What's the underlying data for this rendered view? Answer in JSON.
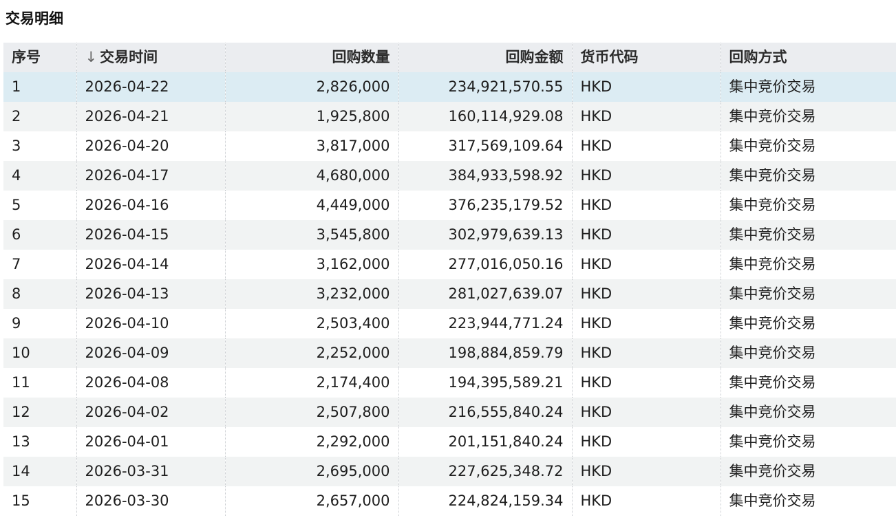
{
  "section": {
    "title": "交易明细"
  },
  "table": {
    "columns": [
      {
        "key": "seq",
        "label": "序号"
      },
      {
        "key": "time",
        "label": "交易时间",
        "sort_glyph": "↓"
      },
      {
        "key": "qty",
        "label": "回购数量"
      },
      {
        "key": "amount",
        "label": "回购金额"
      },
      {
        "key": "currency",
        "label": "货币代码"
      },
      {
        "key": "method",
        "label": "回购方式"
      }
    ],
    "selected_row": 0,
    "rows": [
      {
        "seq": "1",
        "time": "2026-04-22",
        "qty": "2,826,000",
        "amount": "234,921,570.55",
        "currency": "HKD",
        "method": "集中竞价交易"
      },
      {
        "seq": "2",
        "time": "2026-04-21",
        "qty": "1,925,800",
        "amount": "160,114,929.08",
        "currency": "HKD",
        "method": "集中竞价交易"
      },
      {
        "seq": "3",
        "time": "2026-04-20",
        "qty": "3,817,000",
        "amount": "317,569,109.64",
        "currency": "HKD",
        "method": "集中竞价交易"
      },
      {
        "seq": "4",
        "time": "2026-04-17",
        "qty": "4,680,000",
        "amount": "384,933,598.92",
        "currency": "HKD",
        "method": "集中竞价交易"
      },
      {
        "seq": "5",
        "time": "2026-04-16",
        "qty": "4,449,000",
        "amount": "376,235,179.52",
        "currency": "HKD",
        "method": "集中竞价交易"
      },
      {
        "seq": "6",
        "time": "2026-04-15",
        "qty": "3,545,800",
        "amount": "302,979,639.13",
        "currency": "HKD",
        "method": "集中竞价交易"
      },
      {
        "seq": "7",
        "time": "2026-04-14",
        "qty": "3,162,000",
        "amount": "277,016,050.16",
        "currency": "HKD",
        "method": "集中竞价交易"
      },
      {
        "seq": "8",
        "time": "2026-04-13",
        "qty": "3,232,000",
        "amount": "281,027,639.07",
        "currency": "HKD",
        "method": "集中竞价交易"
      },
      {
        "seq": "9",
        "time": "2026-04-10",
        "qty": "2,503,400",
        "amount": "223,944,771.24",
        "currency": "HKD",
        "method": "集中竞价交易"
      },
      {
        "seq": "10",
        "time": "2026-04-09",
        "qty": "2,252,000",
        "amount": "198,884,859.79",
        "currency": "HKD",
        "method": "集中竞价交易"
      },
      {
        "seq": "11",
        "time": "2026-04-08",
        "qty": "2,174,400",
        "amount": "194,395,589.21",
        "currency": "HKD",
        "method": "集中竞价交易"
      },
      {
        "seq": "12",
        "time": "2026-04-02",
        "qty": "2,507,800",
        "amount": "216,555,840.24",
        "currency": "HKD",
        "method": "集中竞价交易"
      },
      {
        "seq": "13",
        "time": "2026-04-01",
        "qty": "2,292,000",
        "amount": "201,151,840.24",
        "currency": "HKD",
        "method": "集中竞价交易"
      },
      {
        "seq": "14",
        "time": "2026-03-31",
        "qty": "2,695,000",
        "amount": "227,625,348.72",
        "currency": "HKD",
        "method": "集中竞价交易"
      },
      {
        "seq": "15",
        "time": "2026-03-30",
        "qty": "2,657,000",
        "amount": "224,824,159.34",
        "currency": "HKD",
        "method": "集中竞价交易"
      }
    ]
  }
}
